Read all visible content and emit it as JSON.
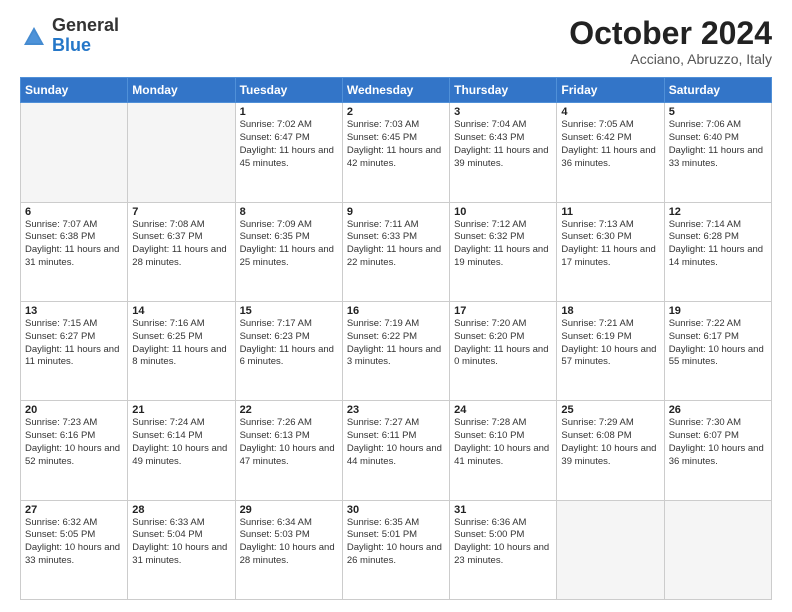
{
  "header": {
    "logo_general": "General",
    "logo_blue": "Blue",
    "month_title": "October 2024",
    "location": "Acciano, Abruzzo, Italy"
  },
  "days_of_week": [
    "Sunday",
    "Monday",
    "Tuesday",
    "Wednesday",
    "Thursday",
    "Friday",
    "Saturday"
  ],
  "weeks": [
    [
      {
        "day": "",
        "empty": true
      },
      {
        "day": "",
        "empty": true
      },
      {
        "day": "1",
        "sunrise": "Sunrise: 7:02 AM",
        "sunset": "Sunset: 6:47 PM",
        "daylight": "Daylight: 11 hours and 45 minutes."
      },
      {
        "day": "2",
        "sunrise": "Sunrise: 7:03 AM",
        "sunset": "Sunset: 6:45 PM",
        "daylight": "Daylight: 11 hours and 42 minutes."
      },
      {
        "day": "3",
        "sunrise": "Sunrise: 7:04 AM",
        "sunset": "Sunset: 6:43 PM",
        "daylight": "Daylight: 11 hours and 39 minutes."
      },
      {
        "day": "4",
        "sunrise": "Sunrise: 7:05 AM",
        "sunset": "Sunset: 6:42 PM",
        "daylight": "Daylight: 11 hours and 36 minutes."
      },
      {
        "day": "5",
        "sunrise": "Sunrise: 7:06 AM",
        "sunset": "Sunset: 6:40 PM",
        "daylight": "Daylight: 11 hours and 33 minutes."
      }
    ],
    [
      {
        "day": "6",
        "sunrise": "Sunrise: 7:07 AM",
        "sunset": "Sunset: 6:38 PM",
        "daylight": "Daylight: 11 hours and 31 minutes."
      },
      {
        "day": "7",
        "sunrise": "Sunrise: 7:08 AM",
        "sunset": "Sunset: 6:37 PM",
        "daylight": "Daylight: 11 hours and 28 minutes."
      },
      {
        "day": "8",
        "sunrise": "Sunrise: 7:09 AM",
        "sunset": "Sunset: 6:35 PM",
        "daylight": "Daylight: 11 hours and 25 minutes."
      },
      {
        "day": "9",
        "sunrise": "Sunrise: 7:11 AM",
        "sunset": "Sunset: 6:33 PM",
        "daylight": "Daylight: 11 hours and 22 minutes."
      },
      {
        "day": "10",
        "sunrise": "Sunrise: 7:12 AM",
        "sunset": "Sunset: 6:32 PM",
        "daylight": "Daylight: 11 hours and 19 minutes."
      },
      {
        "day": "11",
        "sunrise": "Sunrise: 7:13 AM",
        "sunset": "Sunset: 6:30 PM",
        "daylight": "Daylight: 11 hours and 17 minutes."
      },
      {
        "day": "12",
        "sunrise": "Sunrise: 7:14 AM",
        "sunset": "Sunset: 6:28 PM",
        "daylight": "Daylight: 11 hours and 14 minutes."
      }
    ],
    [
      {
        "day": "13",
        "sunrise": "Sunrise: 7:15 AM",
        "sunset": "Sunset: 6:27 PM",
        "daylight": "Daylight: 11 hours and 11 minutes."
      },
      {
        "day": "14",
        "sunrise": "Sunrise: 7:16 AM",
        "sunset": "Sunset: 6:25 PM",
        "daylight": "Daylight: 11 hours and 8 minutes."
      },
      {
        "day": "15",
        "sunrise": "Sunrise: 7:17 AM",
        "sunset": "Sunset: 6:23 PM",
        "daylight": "Daylight: 11 hours and 6 minutes."
      },
      {
        "day": "16",
        "sunrise": "Sunrise: 7:19 AM",
        "sunset": "Sunset: 6:22 PM",
        "daylight": "Daylight: 11 hours and 3 minutes."
      },
      {
        "day": "17",
        "sunrise": "Sunrise: 7:20 AM",
        "sunset": "Sunset: 6:20 PM",
        "daylight": "Daylight: 11 hours and 0 minutes."
      },
      {
        "day": "18",
        "sunrise": "Sunrise: 7:21 AM",
        "sunset": "Sunset: 6:19 PM",
        "daylight": "Daylight: 10 hours and 57 minutes."
      },
      {
        "day": "19",
        "sunrise": "Sunrise: 7:22 AM",
        "sunset": "Sunset: 6:17 PM",
        "daylight": "Daylight: 10 hours and 55 minutes."
      }
    ],
    [
      {
        "day": "20",
        "sunrise": "Sunrise: 7:23 AM",
        "sunset": "Sunset: 6:16 PM",
        "daylight": "Daylight: 10 hours and 52 minutes."
      },
      {
        "day": "21",
        "sunrise": "Sunrise: 7:24 AM",
        "sunset": "Sunset: 6:14 PM",
        "daylight": "Daylight: 10 hours and 49 minutes."
      },
      {
        "day": "22",
        "sunrise": "Sunrise: 7:26 AM",
        "sunset": "Sunset: 6:13 PM",
        "daylight": "Daylight: 10 hours and 47 minutes."
      },
      {
        "day": "23",
        "sunrise": "Sunrise: 7:27 AM",
        "sunset": "Sunset: 6:11 PM",
        "daylight": "Daylight: 10 hours and 44 minutes."
      },
      {
        "day": "24",
        "sunrise": "Sunrise: 7:28 AM",
        "sunset": "Sunset: 6:10 PM",
        "daylight": "Daylight: 10 hours and 41 minutes."
      },
      {
        "day": "25",
        "sunrise": "Sunrise: 7:29 AM",
        "sunset": "Sunset: 6:08 PM",
        "daylight": "Daylight: 10 hours and 39 minutes."
      },
      {
        "day": "26",
        "sunrise": "Sunrise: 7:30 AM",
        "sunset": "Sunset: 6:07 PM",
        "daylight": "Daylight: 10 hours and 36 minutes."
      }
    ],
    [
      {
        "day": "27",
        "sunrise": "Sunrise: 6:32 AM",
        "sunset": "Sunset: 5:05 PM",
        "daylight": "Daylight: 10 hours and 33 minutes."
      },
      {
        "day": "28",
        "sunrise": "Sunrise: 6:33 AM",
        "sunset": "Sunset: 5:04 PM",
        "daylight": "Daylight: 10 hours and 31 minutes."
      },
      {
        "day": "29",
        "sunrise": "Sunrise: 6:34 AM",
        "sunset": "Sunset: 5:03 PM",
        "daylight": "Daylight: 10 hours and 28 minutes."
      },
      {
        "day": "30",
        "sunrise": "Sunrise: 6:35 AM",
        "sunset": "Sunset: 5:01 PM",
        "daylight": "Daylight: 10 hours and 26 minutes."
      },
      {
        "day": "31",
        "sunrise": "Sunrise: 6:36 AM",
        "sunset": "Sunset: 5:00 PM",
        "daylight": "Daylight: 10 hours and 23 minutes."
      },
      {
        "day": "",
        "empty": true
      },
      {
        "day": "",
        "empty": true
      }
    ]
  ]
}
